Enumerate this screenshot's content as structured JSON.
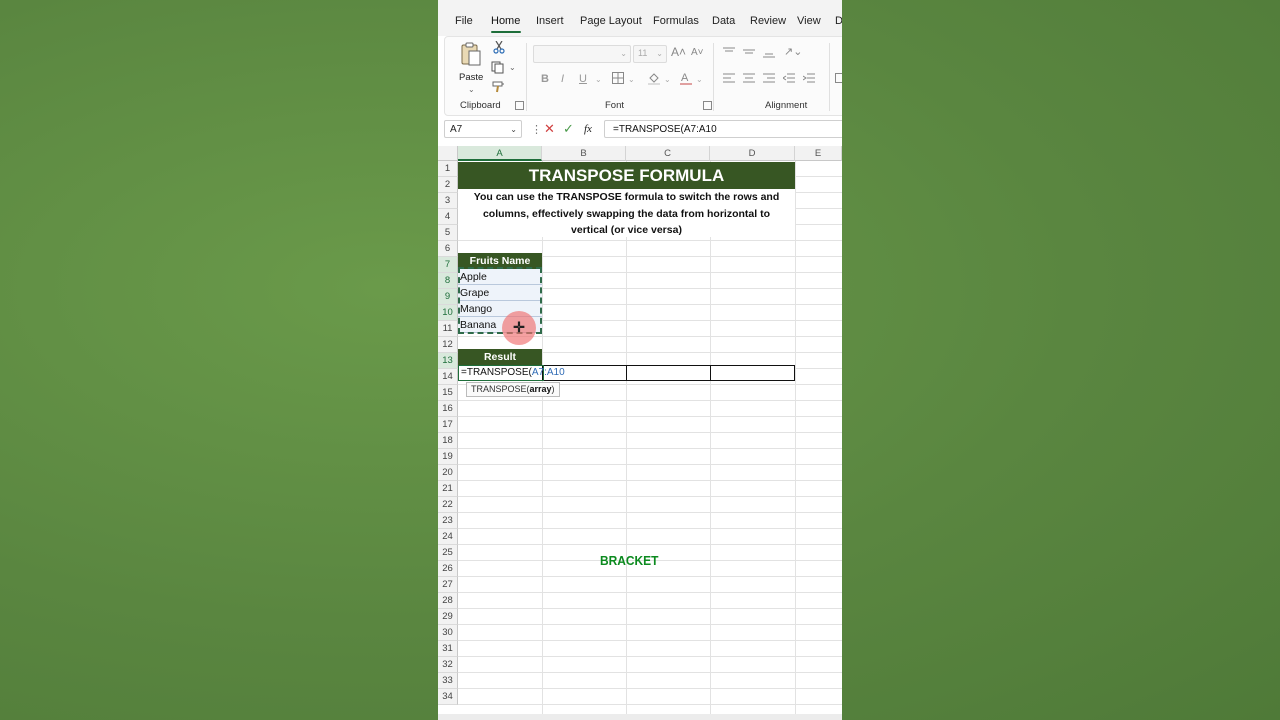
{
  "ribbon": {
    "tabs": [
      {
        "label": "File"
      },
      {
        "label": "Home",
        "active": true
      },
      {
        "label": "Insert"
      },
      {
        "label": "Page Layout"
      },
      {
        "label": "Formulas"
      },
      {
        "label": "Data"
      },
      {
        "label": "Review"
      },
      {
        "label": "View"
      },
      {
        "label": "D"
      }
    ],
    "paste_label": "Paste",
    "font_size": "11",
    "groups": {
      "clipboard": "Clipboard",
      "font": "Font",
      "alignment": "Alignment"
    },
    "icons": [
      "paste-icon",
      "cut-icon",
      "copy-icon",
      "format-painter-icon",
      "bold-icon",
      "italic-icon",
      "underline-icon",
      "borders-icon",
      "fill-color-icon",
      "font-color-icon"
    ]
  },
  "formula_bar": {
    "name_box": "A7",
    "fx": "fx",
    "formula": "=TRANSPOSE(A7:A10"
  },
  "sheet": {
    "columns": [
      "A",
      "B",
      "C",
      "D",
      "E"
    ],
    "title": "TRANSPOSE FORMULA",
    "description_lines": [
      "You can use the TRANSPOSE formula to switch the rows and",
      "columns, effectively swapping the data from horizontal to",
      "vertical (or vice versa)"
    ],
    "fruits_header": "Fruits Name",
    "fruits": [
      "Apple",
      "Grape",
      "Mango",
      "Banana"
    ],
    "result_header": "Result",
    "edit_prefix": "=TRANSPOSE(",
    "edit_ref": "A7:A10",
    "tooltip_func": "TRANSPOSE(",
    "tooltip_arg": "array",
    "tooltip_close": ")",
    "rows": [
      "1",
      "2",
      "3",
      "4",
      "5",
      "6",
      "7",
      "8",
      "9",
      "10",
      "11",
      "12",
      "13",
      "14",
      "15",
      "16",
      "17",
      "18",
      "19",
      "20",
      "21",
      "22",
      "23",
      "24",
      "25",
      "26",
      "27",
      "28",
      "29",
      "30",
      "31",
      "32",
      "33",
      "34"
    ]
  },
  "overlay_text": "BRACKET",
  "colors": {
    "header_green": "#375623",
    "accent_green": "#1e6e3a",
    "overlay_green": "#0c8a1f",
    "background_green": "#5e8a42"
  }
}
